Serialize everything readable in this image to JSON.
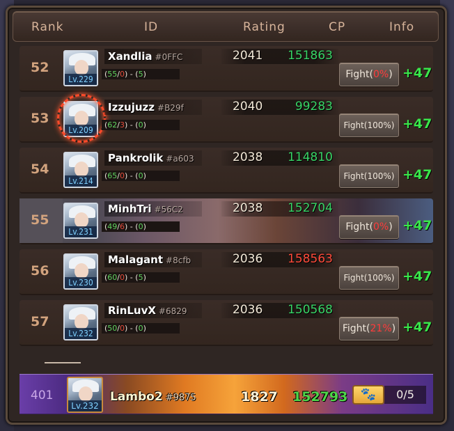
{
  "header": {
    "rank": "Rank",
    "id": "ID",
    "rating": "Rating",
    "cp": "CP",
    "info": "Info"
  },
  "rows": [
    {
      "rank": "52",
      "level": "Lv.229",
      "name": "Xandlia",
      "tag": "#0FFC",
      "rec_wins": "55",
      "rec_losses": "0",
      "rec_extra": "5",
      "rating": "2041",
      "cp": "151863",
      "cp_color": "green",
      "fight_label": "Fight(",
      "fight_pct": "0%",
      "fight_end": ")",
      "fight_pct_red": true,
      "plus": "+47"
    },
    {
      "rank": "53",
      "level": "Lv.209",
      "name": "Izzujuzz",
      "tag": "#B29f",
      "rec_wins": "62",
      "rec_losses": "3",
      "rec_extra": "0",
      "rating": "2040",
      "cp": "99283",
      "cp_color": "green",
      "fight_label": "Fight(",
      "fight_pct": "100%",
      "fight_end": ")",
      "fight_pct_red": false,
      "plus": "+47"
    },
    {
      "rank": "54",
      "level": "Lv.214",
      "name": "Pankrolik",
      "tag": "#a603",
      "rec_wins": "65",
      "rec_losses": "0",
      "rec_extra": "0",
      "rating": "2038",
      "cp": "114810",
      "cp_color": "green",
      "fight_label": "Fight(",
      "fight_pct": "100%",
      "fight_end": ")",
      "fight_pct_red": false,
      "plus": "+47"
    },
    {
      "rank": "55",
      "level": "Lv.231",
      "name": "MinhTri",
      "tag": "#56C2",
      "rec_wins": "49",
      "rec_losses": "6",
      "rec_extra": "0",
      "rating": "2038",
      "cp": "152704",
      "cp_color": "green",
      "fight_label": "Fight(",
      "fight_pct": "0%",
      "fight_end": ")",
      "fight_pct_red": true,
      "plus": "+47"
    },
    {
      "rank": "56",
      "level": "Lv.230",
      "name": "Malagant",
      "tag": "#8cfb",
      "rec_wins": "60",
      "rec_losses": "0",
      "rec_extra": "5",
      "rating": "2036",
      "cp": "158563",
      "cp_color": "red",
      "fight_label": "Fight(",
      "fight_pct": "100%",
      "fight_end": ")",
      "fight_pct_red": false,
      "plus": "+47"
    },
    {
      "rank": "57",
      "level": "Lv.232",
      "name": "RinLuvX",
      "tag": "#6829",
      "rec_wins": "50",
      "rec_losses": "0",
      "rec_extra": "0",
      "rating": "2036",
      "cp": "150568",
      "cp_color": "green",
      "fight_label": "Fight(",
      "fight_pct": "21%",
      "fight_end": ")",
      "fight_pct_red": true,
      "plus": "+47"
    }
  ],
  "me": {
    "rank": "401",
    "level": "Lv.232",
    "name": "Lambo2",
    "tag": "#9875",
    "rating": "1827",
    "cp": "152793",
    "ticket_icon": "paw-ticket-icon",
    "tickets": "0/5"
  },
  "colors": {
    "cp_green": "#38d466",
    "cp_red": "#ff4a3a",
    "plus": "#39e64a"
  }
}
